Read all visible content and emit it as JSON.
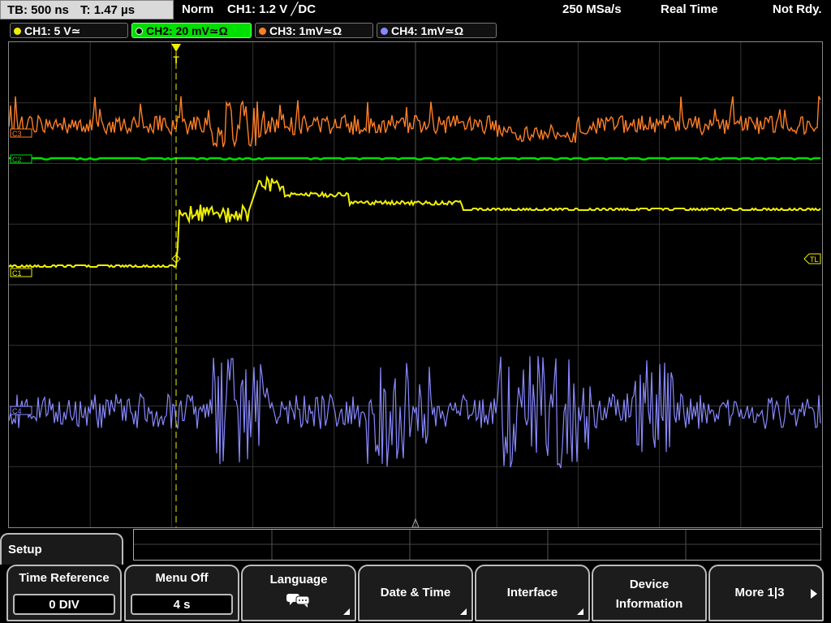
{
  "status": {
    "timebase": "TB: 500 ns",
    "trigger_time": "T: 1.47 µs",
    "trigger_mode": "Norm",
    "trigger_source": "CH1: 1.2 V ╱DC",
    "sample_rate": "250 MSa/s",
    "acq_mode": "Real Time",
    "ready_state": "Not Rdy."
  },
  "channels": [
    {
      "label": "CH1: 5 V≃",
      "color": "#f0f000"
    },
    {
      "label": "CH2: 20 mV≃Ω",
      "color": "#00e000"
    },
    {
      "label": "CH3: 1mV≃Ω",
      "color": "#ff7f27"
    },
    {
      "label": "CH4: 1mV≃Ω",
      "color": "#8888ff"
    }
  ],
  "markers": {
    "ch3": "C3",
    "ch2": "C2",
    "ch1": "C1",
    "ch4": "C4",
    "trigger_level": "TL",
    "trigger_pos": "T"
  },
  "menu": {
    "title": "Setup",
    "time_reference": {
      "label": "Time Reference",
      "value": "0 DIV"
    },
    "menu_off": {
      "label": "Menu Off",
      "value": "4 s"
    },
    "language": {
      "label": "Language"
    },
    "date_time": {
      "label": "Date & Time"
    },
    "interface": {
      "label": "Interface"
    },
    "device_info": {
      "line1": "Device",
      "line2": "Information"
    },
    "more": {
      "label": "More 1|3"
    }
  },
  "colors": {
    "ch1": "#f0f000",
    "ch2": "#00e000",
    "ch3": "#ff7f27",
    "ch4": "#8888ff",
    "grid": "#3a3a3a"
  }
}
